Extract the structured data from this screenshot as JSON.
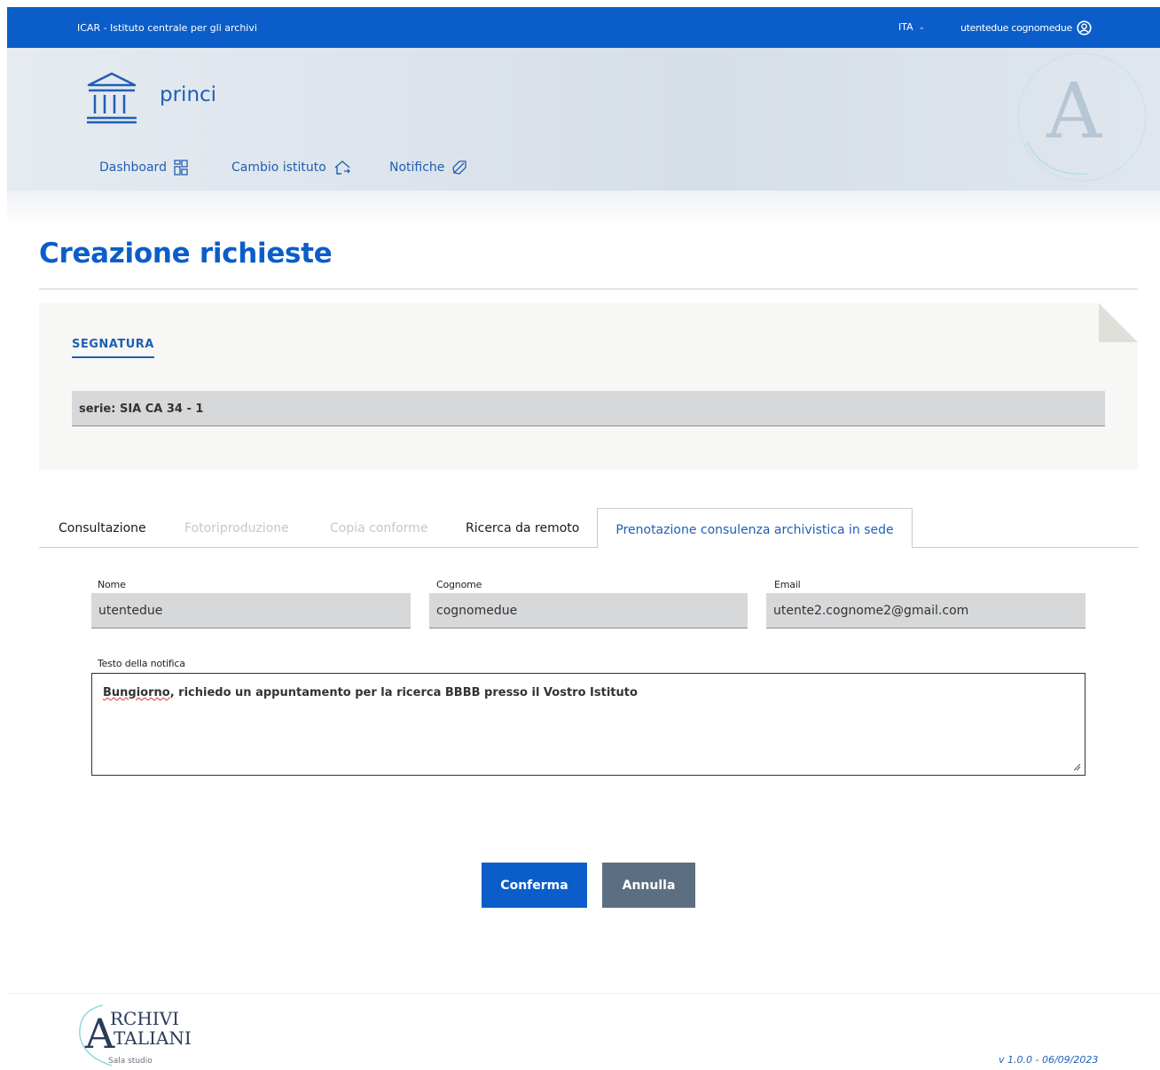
{
  "topbar": {
    "org_name": "ICAR - Istituto centrale per gli archivi",
    "language": "ITA",
    "user_name": "utentedue cognomedue"
  },
  "header": {
    "institute_name": "princi",
    "watermark_letter": "A",
    "nav": [
      {
        "label": "Dashboard",
        "icon": "dashboard-grid-icon"
      },
      {
        "label": "Cambio istituto",
        "icon": "home-switch-icon"
      },
      {
        "label": "Notifiche",
        "icon": "megaphone-icon"
      }
    ]
  },
  "page": {
    "title": "Creazione richieste"
  },
  "segnatura": {
    "label": "SEGNATURA",
    "value": "serie: SIA CA 34 - 1"
  },
  "tabs": [
    {
      "label": "Consultazione",
      "state": "enabled"
    },
    {
      "label": "Fotoriproduzione",
      "state": "disabled"
    },
    {
      "label": "Copia conforme",
      "state": "disabled"
    },
    {
      "label": "Ricerca da remoto",
      "state": "enabled"
    },
    {
      "label": "Prenotazione consulenza archivistica in sede",
      "state": "active"
    }
  ],
  "form": {
    "nome_label": "Nome",
    "nome_value": "utentedue",
    "cognome_label": "Cognome",
    "cognome_value": "cognomedue",
    "email_label": "Email",
    "email_value": "utente2.cognome2@gmail.com",
    "testo_label": "Testo della notifica",
    "testo_first_word": "Bungiorno",
    "testo_rest": ", richiedo un appuntamento per la ricerca BBBB presso il Vostro Istituto"
  },
  "buttons": {
    "confirm_label": "Conferma",
    "cancel_label": "Annulla"
  },
  "footer": {
    "logo_line1": "RCHIVI",
    "logo_line2": "TALIANI",
    "logo_subtitle": "Sala studio",
    "version": "v 1.0.0 - 06/09/2023"
  },
  "colors": {
    "primary": "#0b5ec9",
    "link": "#1f5fb3",
    "cancel_button": "#5c6f82",
    "input_bg": "#d7d8da"
  }
}
